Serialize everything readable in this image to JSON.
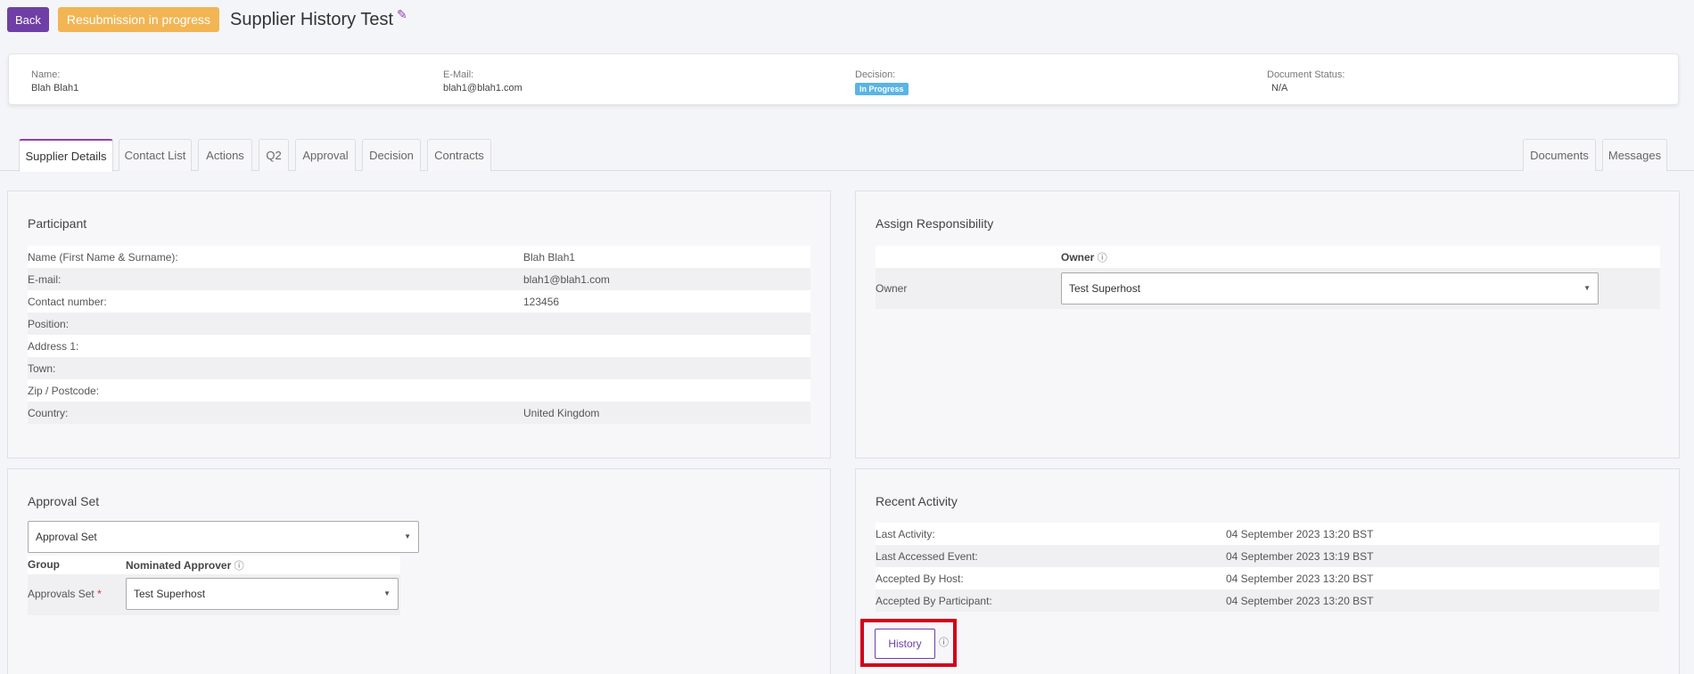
{
  "header": {
    "back_label": "Back",
    "status_badge": "Resubmission in progress",
    "title": "Supplier History Test"
  },
  "summary": {
    "name_label": "Name:",
    "name_value": "Blah Blah1",
    "email_label": "E-Mail:",
    "email_value": "blah1@blah1.com",
    "decision_label": "Decision:",
    "decision_value": "In Progress",
    "doc_status_label": "Document Status:",
    "doc_status_value": "N/A"
  },
  "tabs": {
    "supplier_details": "Supplier Details",
    "contact_list": "Contact List",
    "actions": "Actions",
    "q2": "Q2",
    "approval": "Approval",
    "decision": "Decision",
    "contracts": "Contracts",
    "documents": "Documents",
    "messages": "Messages"
  },
  "participant": {
    "title": "Participant",
    "rows": [
      {
        "label": "Name (First Name & Surname):",
        "value": "Blah Blah1"
      },
      {
        "label": "E-mail:",
        "value": "blah1@blah1.com"
      },
      {
        "label": "Contact number:",
        "value": "123456"
      },
      {
        "label": "Position:",
        "value": ""
      },
      {
        "label": "Address 1:",
        "value": ""
      },
      {
        "label": "Town:",
        "value": ""
      },
      {
        "label": "Zip / Postcode:",
        "value": ""
      },
      {
        "label": "Country:",
        "value": "United Kingdom"
      }
    ]
  },
  "responsibility": {
    "title": "Assign Responsibility",
    "owner_header": "Owner",
    "owner_row_label": "Owner",
    "owner_selected": "Test Superhost"
  },
  "approval_set": {
    "title": "Approval Set",
    "set_selected": "Approval Set",
    "group_header": "Group",
    "approver_header": "Nominated Approver",
    "row_label": "Approvals Set",
    "required_mark": "*",
    "approver_selected": "Test Superhost"
  },
  "recent_activity": {
    "title": "Recent Activity",
    "rows": [
      {
        "label": "Last Activity:",
        "value": "04 September 2023 13:20 BST"
      },
      {
        "label": "Last Accessed Event:",
        "value": "04 September 2023 13:19 BST"
      },
      {
        "label": "Accepted By Host:",
        "value": "04 September 2023 13:20 BST"
      },
      {
        "label": "Accepted By Participant:",
        "value": "04 September 2023 13:20 BST"
      }
    ],
    "history_label": "History"
  },
  "icons": {
    "info_glyph": "ⓘ",
    "caret_glyph": "▼",
    "edit_glyph": "✎"
  }
}
